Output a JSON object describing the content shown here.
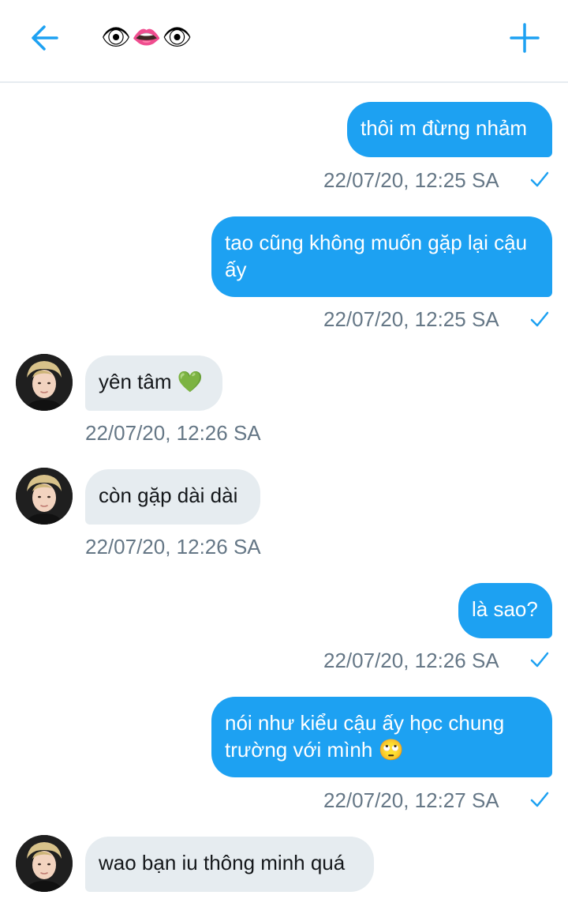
{
  "header": {
    "back_icon": "arrow-left-icon",
    "title": "👁👄👁",
    "plus_icon": "plus-icon",
    "accent": "#1da1f2"
  },
  "colors": {
    "outgoing_bubble": "#1da1f2",
    "incoming_bubble": "#e6ecf0",
    "timestamp": "#657786"
  },
  "messages": [
    {
      "direction": "out",
      "text": "thôi m đừng nhảm",
      "time": "22/07/20, 12:25 SA",
      "status_icon": "check-icon"
    },
    {
      "direction": "out",
      "text": "tao cũng không muốn gặp lại cậu ấy",
      "time": "22/07/20, 12:25 SA",
      "status_icon": "check-icon"
    },
    {
      "direction": "in",
      "text": "yên tâm 💚",
      "time": "22/07/20, 12:26 SA",
      "avatar": "avatar"
    },
    {
      "direction": "in",
      "text": "còn gặp dài dài",
      "time": "22/07/20, 12:26 SA",
      "avatar": "avatar"
    },
    {
      "direction": "out",
      "text": "là sao?",
      "time": "22/07/20, 12:26 SA",
      "status_icon": "check-icon"
    },
    {
      "direction": "out",
      "text": "nói như kiểu cậu ấy học chung trường với mình 🙄",
      "time": "22/07/20, 12:27 SA",
      "status_icon": "check-icon"
    },
    {
      "direction": "in",
      "text": "wao bạn iu thông minh quá",
      "time": "",
      "avatar": "avatar"
    }
  ]
}
